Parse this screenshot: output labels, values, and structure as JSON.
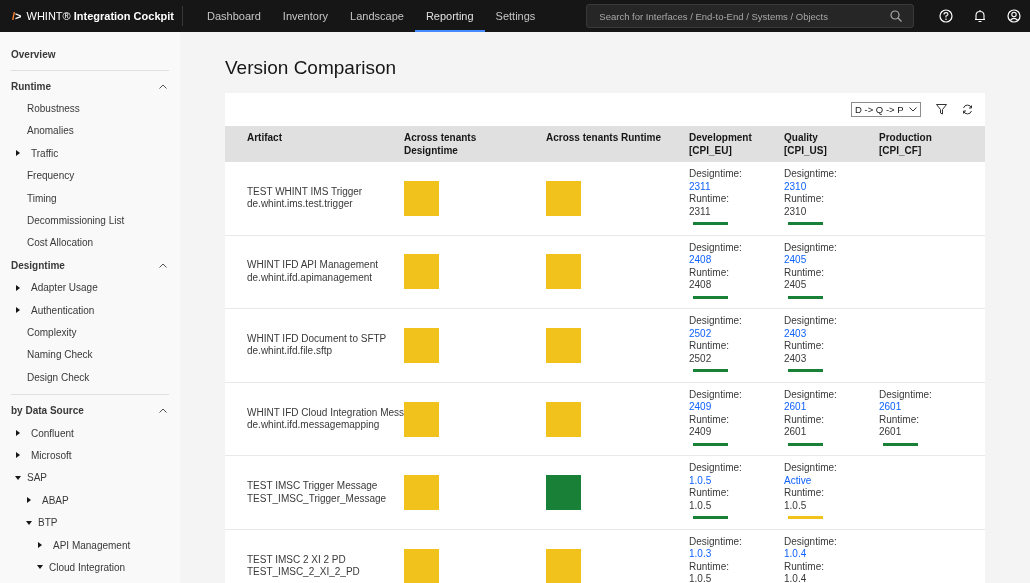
{
  "header": {
    "logo_mark": "/>",
    "product": "WHINT® **Integration Cockpit**",
    "tabs": [
      {
        "label": "Dashboard",
        "selected": false
      },
      {
        "label": "Inventory",
        "selected": false
      },
      {
        "label": "Landscape",
        "selected": false
      },
      {
        "label": "Reporting",
        "selected": true
      },
      {
        "label": "Settings",
        "selected": false
      }
    ],
    "search": {
      "placeholder": "Search for Interfaces / End-to-End / Systems / Objects"
    }
  },
  "sidebar": {
    "overview": "Overview",
    "sections": [
      {
        "label": "Runtime",
        "expanded": true,
        "divider": true,
        "items": [
          {
            "label": "Robustness"
          },
          {
            "label": "Anomalies"
          },
          {
            "label": "Traffic",
            "expanded": false
          },
          {
            "label": "Frequency"
          },
          {
            "label": "Timing"
          },
          {
            "label": "Decommissioning List"
          },
          {
            "label": "Cost Allocation"
          }
        ]
      },
      {
        "label": "Designtime",
        "expanded": true,
        "divider": false,
        "items": [
          {
            "label": "Adapter Usage",
            "expanded": false
          },
          {
            "label": "Authentication",
            "expanded": false
          },
          {
            "label": "Complexity"
          },
          {
            "label": "Naming Check"
          },
          {
            "label": "Design Check"
          }
        ]
      },
      {
        "label": "by Data Source",
        "expanded": true,
        "divider": true,
        "items": [
          {
            "label": "Confluent",
            "expanded": false
          },
          {
            "label": "Microsoft",
            "expanded": false
          },
          {
            "label": "SAP",
            "expanded": true,
            "children": [
              {
                "label": "ABAP",
                "expanded": false
              },
              {
                "label": "BTP",
                "expanded": true,
                "children": [
                  {
                    "label": "API Management",
                    "expanded": false
                  },
                  {
                    "label": "Cloud Integration",
                    "expanded": true
                  }
                ]
              }
            ]
          }
        ]
      }
    ]
  },
  "page": {
    "title": "Version Comparison",
    "path_select": {
      "value": "D -> Q -> P"
    },
    "table": {
      "columns": [
        "Artifact",
        "Across tenants Designtime",
        "Across tenants Runtime",
        "Development [CPI_EU]",
        "Quality [CPI_US]",
        "Production [CPI_CF]"
      ],
      "rows": [
        {
          "name": "TEST WHINT IMS Trigger",
          "id": "de.whint.ims.test.trigger",
          "squares": [
            {
              "color": "#f1c21b"
            },
            {
              "color": "#f1c21b"
            }
          ],
          "tenants": {
            "development": {
              "designtime_label": "Designtime:",
              "designtime": "2311",
              "runtime_label": "Runtime:",
              "runtime": "2311",
              "color": "#198038"
            },
            "quality": {
              "designtime_label": "Designtime:",
              "designtime": "2310",
              "runtime_label": "Runtime:",
              "runtime": "2310",
              "color": "#198038"
            }
          }
        },
        {
          "name": "WHINT IFD API Management",
          "id": "de.whint.ifd.apimanagement",
          "squares": [
            {
              "color": "#f1c21b"
            },
            {
              "color": "#f1c21b"
            }
          ],
          "tenants": {
            "development": {
              "designtime_label": "Designtime:",
              "designtime": "2408",
              "runtime_label": "Runtime:",
              "runtime": "2408",
              "color": "#198038"
            },
            "quality": {
              "designtime_label": "Designtime:",
              "designtime": "2405",
              "runtime_label": "Runtime:",
              "runtime": "2405",
              "color": "#198038"
            }
          }
        },
        {
          "name": "WHINT IFD Document to SFTP",
          "id": "de.whint.ifd.file.sftp",
          "squares": [
            {
              "color": "#f1c21b"
            },
            {
              "color": "#f1c21b"
            }
          ],
          "tenants": {
            "development": {
              "designtime_label": "Designtime:",
              "designtime": "2502",
              "runtime_label": "Runtime:",
              "runtime": "2502",
              "color": "#198038"
            },
            "quality": {
              "designtime_label": "Designtime:",
              "designtime": "2403",
              "runtime_label": "Runtime:",
              "runtime": "2403",
              "color": "#198038"
            }
          }
        },
        {
          "name": "WHINT IFD Cloud Integration Mess",
          "id": "de.whint.ifd.messagemapping",
          "squares": [
            {
              "color": "#f1c21b"
            },
            {
              "color": "#f1c21b"
            }
          ],
          "tenants": {
            "development": {
              "designtime_label": "Designtime:",
              "designtime": "2409",
              "runtime_label": "Runtime:",
              "runtime": "2409",
              "color": "#198038"
            },
            "quality": {
              "designtime_label": "Designtime:",
              "designtime": "2601",
              "runtime_label": "Runtime:",
              "runtime": "2601",
              "color": "#198038"
            },
            "production": {
              "designtime_label": "Designtime:",
              "designtime": "2601",
              "runtime_label": "Runtime:",
              "runtime": "2601",
              "color": "#198038"
            }
          }
        },
        {
          "name": "TEST IMSC Trigger Message",
          "id": "TEST_IMSC_Trigger_Message",
          "squares": [
            {
              "color": "#f1c21b"
            },
            {
              "color": "#198038"
            }
          ],
          "tenants": {
            "development": {
              "designtime_label": "Designtime:",
              "designtime": "1.0.5",
              "runtime_label": "Runtime:",
              "runtime": "1.0.5",
              "color": "#198038"
            },
            "quality": {
              "designtime_label": "Designtime:",
              "designtime": "Active",
              "runtime_label": "Runtime:",
              "runtime": "1.0.5",
              "color": "#f1c21b"
            }
          }
        },
        {
          "name": "TEST IMSC 2 XI 2 PD",
          "id": "TEST_IMSC_2_XI_2_PD",
          "squares": [
            {
              "color": "#f1c21b"
            },
            {
              "color": "#f1c21b"
            }
          ],
          "tenants": {
            "development": {
              "designtime_label": "Designtime:",
              "designtime": "1.0.3",
              "runtime_label": "Runtime:",
              "runtime": "1.0.5"
            },
            "quality": {
              "designtime_label": "Designtime:",
              "designtime": "1.0.4",
              "runtime_label": "Runtime:",
              "runtime": "1.0.4"
            }
          }
        }
      ]
    }
  }
}
